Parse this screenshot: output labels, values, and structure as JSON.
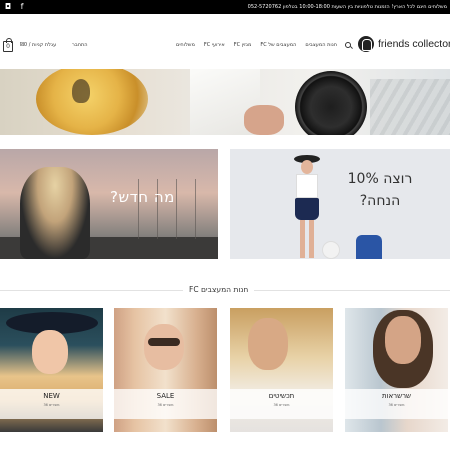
{
  "topbar": {
    "promo_text": "משלוחים חינם לכל הארץ! הזמנות טלפוניות בין השעות 10:00-18:00 בטלפון 052-5720762",
    "social": {
      "instagram": "instagram-icon",
      "facebook": "facebook-icon"
    }
  },
  "header": {
    "cart_count": "0",
    "cart_label": "עגלת קניות / ₪0",
    "login_label": "התחבר",
    "nav": [
      "חנות המעצבים",
      "המעצבים של FC",
      "מגזין FC",
      "אירועי FC",
      "משלוחים"
    ],
    "logo_text": "friends collector"
  },
  "promo": {
    "left_caption": "מה חדש?",
    "right_caption": "רוצה 10% הנחה?"
  },
  "section": {
    "title": "חנות המעצבים FC"
  },
  "categories": [
    {
      "name": "NEW",
      "sub": "36 מוצרים"
    },
    {
      "name": "SALE",
      "sub": "36 מוצרים"
    },
    {
      "name": "תכשיטים",
      "sub": "36 מוצרים"
    },
    {
      "name": "שרשראות",
      "sub": "36 מוצרים"
    }
  ],
  "colors": {
    "topbar_bg": "#000000",
    "text": "#222222",
    "skirt_navy": "#1c2a52"
  }
}
